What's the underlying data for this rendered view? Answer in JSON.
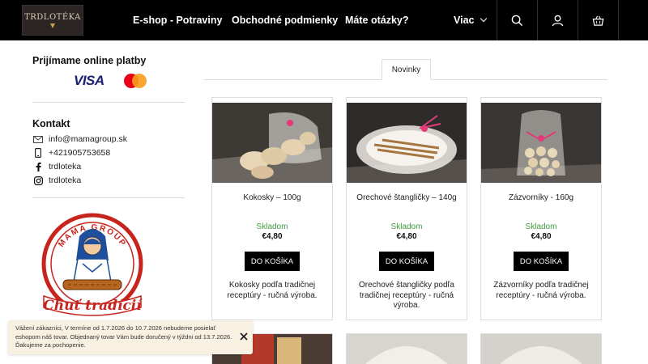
{
  "header": {
    "logo_text": "TRDLOTÉKA",
    "nav": [
      "E-shop - Potraviny",
      "Obchodné podmienky",
      "Máte otázky?"
    ],
    "more_label": "Viac",
    "icons": [
      "search-icon",
      "user-icon",
      "basket-icon"
    ],
    "colors": {
      "bg": "#000000",
      "text": "#ffffff"
    }
  },
  "sidebar": {
    "payments_title": "Prijímame online platby",
    "visa_label": "VISA",
    "contact_title": "Kontakt",
    "contacts": [
      {
        "icon": "mail-icon",
        "text": "info@mamagroup.sk"
      },
      {
        "icon": "phone-icon",
        "text": "+421905753658"
      },
      {
        "icon": "facebook-icon",
        "text": "trdloteka"
      },
      {
        "icon": "instagram-icon",
        "text": "trdloteka"
      }
    ],
    "badge": {
      "top_text": "MAMA GROUP",
      "script_text": "Chuť tradícií"
    }
  },
  "tabs": [
    "Novinky"
  ],
  "products": [
    {
      "name": "Kokosky – 100g",
      "stock": "Skladom",
      "price": "€4,80",
      "button": "DO KOŠÍKA",
      "description": "Kokosky podľa tradičnej receptúry - ručná výroba."
    },
    {
      "name": "Orechové štangličky – 140g",
      "stock": "Skladom",
      "price": "€4,80",
      "button": "DO KOŠÍKA",
      "description": "Orechové štangličky podľa tradičnej receptúry - ručná výroba."
    },
    {
      "name": "Zázvorníky - 160g",
      "stock": "Skladom",
      "price": "€4,80",
      "button": "DO KOŠÍKA",
      "description": "Zázvorníky podľa tradičnej receptúry - ručná výroba."
    }
  ],
  "notice": {
    "text": "Vážení zákazníci, V termíne od 1.7.2026 do 10.7.2026 nebudeme posielať eshopom náš tovar. Objednaný tovar Vám bude doručený v týždni od 13.7.2026. Ďakujeme za pochopenie."
  },
  "colors": {
    "stock": "#3e9c3e",
    "button": "#000000",
    "notice_bg": "#f8f0e0"
  }
}
